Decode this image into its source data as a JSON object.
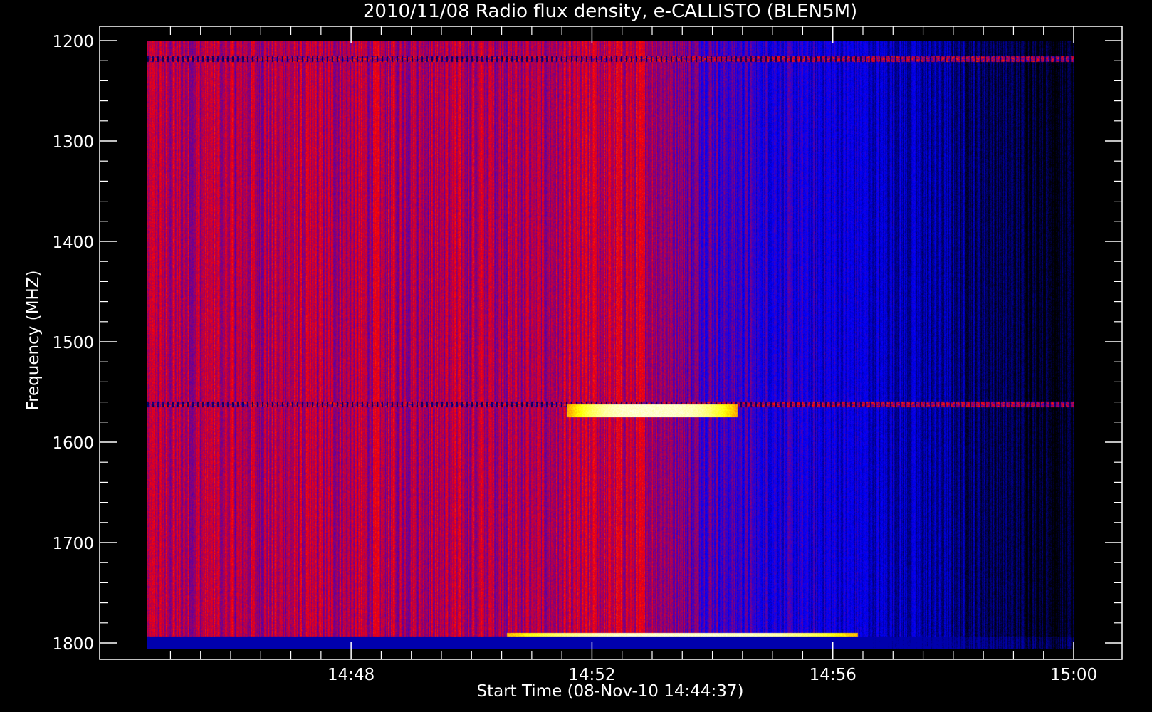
{
  "chart_data": {
    "type": "heatmap",
    "title": "2010/11/08  Radio flux density, e-CALLISTO (BLEN5M)",
    "xlabel": "Start Time (08-Nov-10 14:44:37)",
    "ylabel": "Frequency (MHZ)",
    "x_range": [
      "14:44:37",
      "15:00:00"
    ],
    "x_ticks": [
      "14:48",
      "14:52",
      "14:56",
      "15:00"
    ],
    "y_range": [
      1200,
      1800
    ],
    "y_ticks": [
      "1200",
      "1300",
      "1400",
      "1500",
      "1600",
      "1700",
      "1800"
    ],
    "y_axis_inverted": true,
    "colormap": [
      "#000000",
      "#0000ff",
      "#ff0000",
      "#ffff00",
      "#ffffff"
    ],
    "features": [
      {
        "kind": "interference_line",
        "frequency_mhz": 1218
      },
      {
        "kind": "interference_line",
        "frequency_mhz": 1562
      },
      {
        "kind": "burst_band",
        "frequency_mhz": [
          1562,
          1575
        ],
        "time": [
          "14:52",
          "14:54"
        ]
      },
      {
        "kind": "burst_band",
        "frequency_mhz": [
          1790,
          1800
        ],
        "time": [
          "14:51",
          "14:56"
        ]
      }
    ],
    "grid": false,
    "legend": "none"
  }
}
